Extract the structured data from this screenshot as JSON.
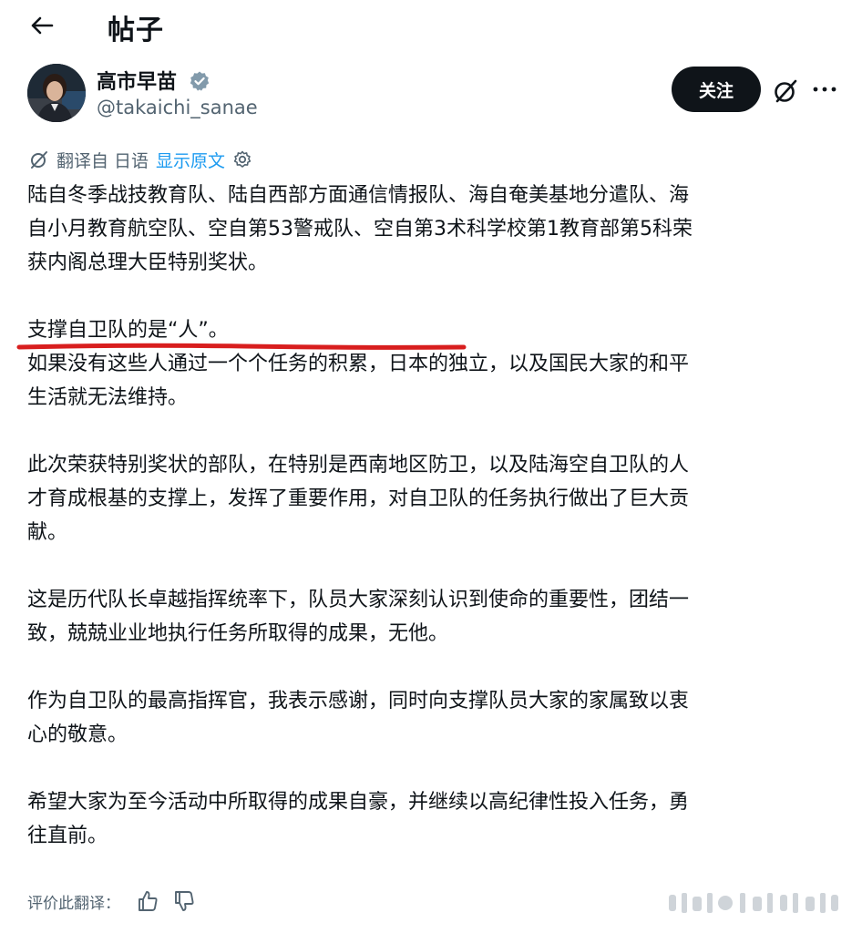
{
  "header": {
    "title": "帖子"
  },
  "author": {
    "name": "高市早苗",
    "handle": "@takaichi_sanae"
  },
  "actions": {
    "follow_label": "关注"
  },
  "translation": {
    "label": "翻译自 日语",
    "show_original": "显示原文"
  },
  "post": {
    "paragraphs": [
      [
        "陆自冬季战技教育队、陆自西部方面通信情报队、海自奄美基地分遣队、海",
        "自小月教育航空队、空自第53警戒队、空自第3术科学校第1教育部第5科荣",
        "获内阁总理大臣特别奖状。"
      ],
      [
        "支撑自卫队的是“人”。",
        "如果没有这些人通过一个个任务的积累，日本的独立，以及国民大家的和平",
        "生活就无法维持。"
      ],
      [
        "此次荣获特别奖状的部队，在特别是西南地区防卫，以及陆海空自卫队的人",
        "才育成根基的支撑上，发挥了重要作用，对自卫队的任务执行做出了巨大贡",
        "献。"
      ],
      [
        "这是历代队长卓越指挥统率下，队员大家深刻认识到使命的重要性，团结一",
        "致，兢兢业业地执行任务所取得的成果，无他。"
      ],
      [
        "作为自卫队的最高指挥官，我表示感谢，同时向支撑队员大家的家属致以衷",
        "心的敬意。"
      ],
      [
        "希望大家为至今活动中所取得的成果自豪，并继续以高纪律性投入任务，勇",
        "往直前。"
      ]
    ]
  },
  "footer": {
    "rate_label": "评价此翻译："
  },
  "colors": {
    "text": "#0f1419",
    "secondary": "#536471",
    "link": "#1d9bf0",
    "underline": "#d81e1e",
    "verified": "#829aab"
  }
}
